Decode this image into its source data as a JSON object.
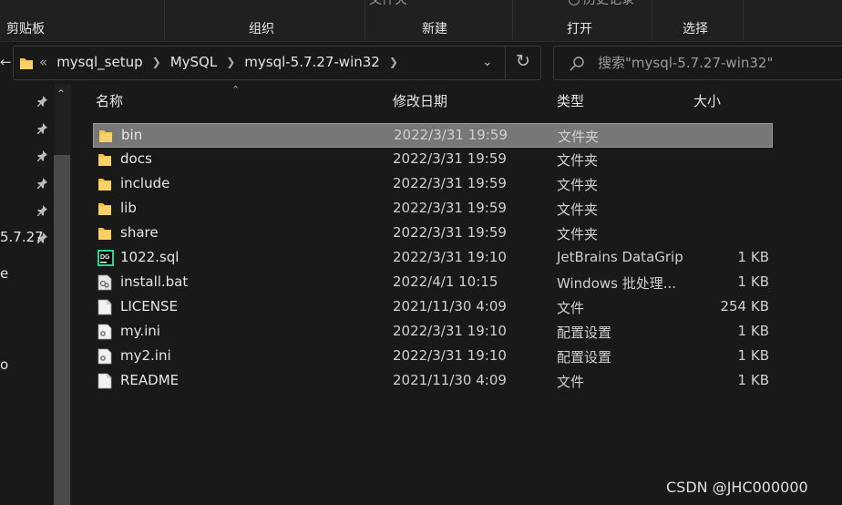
{
  "ribbon": {
    "cut_labels": [
      "文件夹",
      "历史记录"
    ],
    "groups": [
      "剪贴板",
      "组织",
      "新建",
      "打开",
      "选择"
    ]
  },
  "address": {
    "overflow": "«",
    "crumbs": [
      "mysql_setup",
      "MySQL",
      "mysql-5.7.27-win32"
    ]
  },
  "search": {
    "placeholder": "搜索\"mysql-5.7.27-win32\""
  },
  "nav": {
    "partial_labels": [
      "5.7.27",
      "e",
      "o"
    ]
  },
  "columns": {
    "name": "名称",
    "date": "修改日期",
    "type": "类型",
    "size": "大小"
  },
  "files": [
    {
      "name": "bin",
      "date": "2022/3/31 19:59",
      "type": "文件夹",
      "size": "",
      "icon": "folder-icon",
      "selected": true
    },
    {
      "name": "docs",
      "date": "2022/3/31 19:59",
      "type": "文件夹",
      "size": "",
      "icon": "folder-icon"
    },
    {
      "name": "include",
      "date": "2022/3/31 19:59",
      "type": "文件夹",
      "size": "",
      "icon": "folder-icon"
    },
    {
      "name": "lib",
      "date": "2022/3/31 19:59",
      "type": "文件夹",
      "size": "",
      "icon": "folder-icon"
    },
    {
      "name": "share",
      "date": "2022/3/31 19:59",
      "type": "文件夹",
      "size": "",
      "icon": "folder-icon"
    },
    {
      "name": "1022.sql",
      "date": "2022/3/31 19:10",
      "type": "JetBrains DataGrip",
      "size": "1 KB",
      "icon": "datagrip-icon"
    },
    {
      "name": "install.bat",
      "date": "2022/4/1 10:15",
      "type": "Windows 批处理...",
      "size": "1 KB",
      "icon": "batch-file-icon"
    },
    {
      "name": "LICENSE",
      "date": "2021/11/30 4:09",
      "type": "文件",
      "size": "254 KB",
      "icon": "file-icon"
    },
    {
      "name": "my.ini",
      "date": "2022/3/31 19:10",
      "type": "配置设置",
      "size": "1 KB",
      "icon": "config-file-icon"
    },
    {
      "name": "my2.ini",
      "date": "2022/3/31 19:10",
      "type": "配置设置",
      "size": "1 KB",
      "icon": "config-file-icon"
    },
    {
      "name": "README",
      "date": "2021/11/30 4:09",
      "type": "文件",
      "size": "1 KB",
      "icon": "file-icon"
    }
  ],
  "watermark": "CSDN @JHC000000",
  "colors": {
    "background": "#191919",
    "selected_row": "#777777",
    "folder": "#F6C244"
  }
}
